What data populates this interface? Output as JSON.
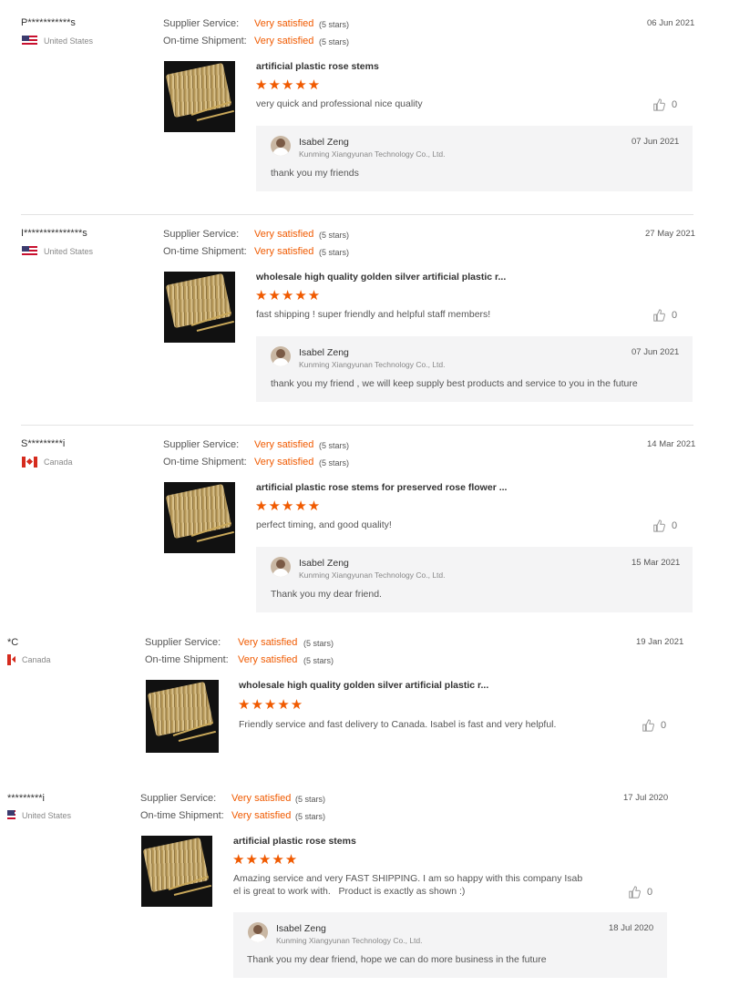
{
  "labels": {
    "supplier_service": "Supplier Service:",
    "ontime_shipment": "On-time Shipment:",
    "very_satisfied": "Very satisfied",
    "five_stars": "(5 stars)"
  },
  "colors": {
    "accent": "#f05a00",
    "reply_bg": "#f4f4f5"
  },
  "icons": {
    "like": "thumbs-up-icon",
    "rating": "star-icon"
  },
  "reviews": [
    {
      "buyer": "P***********s",
      "country": "United States",
      "flag": "us-flag-icon",
      "date": "06 Jun 2021",
      "product": "artificial plastic rose stems",
      "rating": 5,
      "stars": "★★★★★",
      "comment": "very quick and professional nice quality",
      "likes": "0",
      "reply": {
        "name": "Isabel Zeng",
        "company": "Kunming Xiangyunan Technology Co., Ltd.",
        "date": "07 Jun 2021",
        "text": "thank you my friends"
      }
    },
    {
      "buyer": "I***************s",
      "country": "United States",
      "flag": "us-flag-icon",
      "date": "27 May 2021",
      "product": "wholesale high quality golden silver artificial plastic r...",
      "rating": 5,
      "stars": "★★★★★",
      "comment": "fast shipping ! super friendly and helpful staff members!",
      "likes": "0",
      "reply": {
        "name": "Isabel Zeng",
        "company": "Kunming Xiangyunan Technology Co., Ltd.",
        "date": "07 Jun 2021",
        "text": "thank you my friend , we will keep supply best products and service to you in the future"
      }
    },
    {
      "buyer": "S*********i",
      "country": "Canada",
      "flag": "canada-flag-icon",
      "date": "14 Mar 2021",
      "product": "artificial plastic rose stems for preserved rose flower ...",
      "rating": 5,
      "stars": "★★★★★",
      "comment": "perfect timing, and good quality!",
      "likes": "0",
      "reply": {
        "name": "Isabel Zeng",
        "company": "Kunming Xiangyunan Technology Co., Ltd.",
        "date": "15 Mar 2021",
        "text": "Thank you my dear friend."
      }
    },
    {
      "buyer": "*C",
      "country": "Canada",
      "flag": "canada-flag-icon",
      "date": "19 Jan 2021",
      "product": "wholesale high quality golden silver artificial plastic r...",
      "rating": 5,
      "stars": "★★★★★",
      "comment": "Friendly service and fast delivery to Canada. Isabel is fast and very helpful.",
      "likes": "0"
    },
    {
      "buyer": "*********i",
      "country": "United States",
      "flag": "us-flag-icon",
      "date": "17 Jul 2020",
      "product": "artificial plastic rose stems",
      "rating": 5,
      "stars": "★★★★★",
      "comment_line1": "Amazing service and very FAST SHIPPING. I am so happy with this company Isab",
      "comment_line2": "el is great to work with.   Product is exactly as shown :)",
      "likes": "0",
      "reply": {
        "name": "Isabel Zeng",
        "company": "Kunming Xiangyunan Technology Co., Ltd.",
        "date": "18 Jul 2020",
        "text": "Thank you my dear friend, hope we can do more business in the future"
      }
    }
  ]
}
